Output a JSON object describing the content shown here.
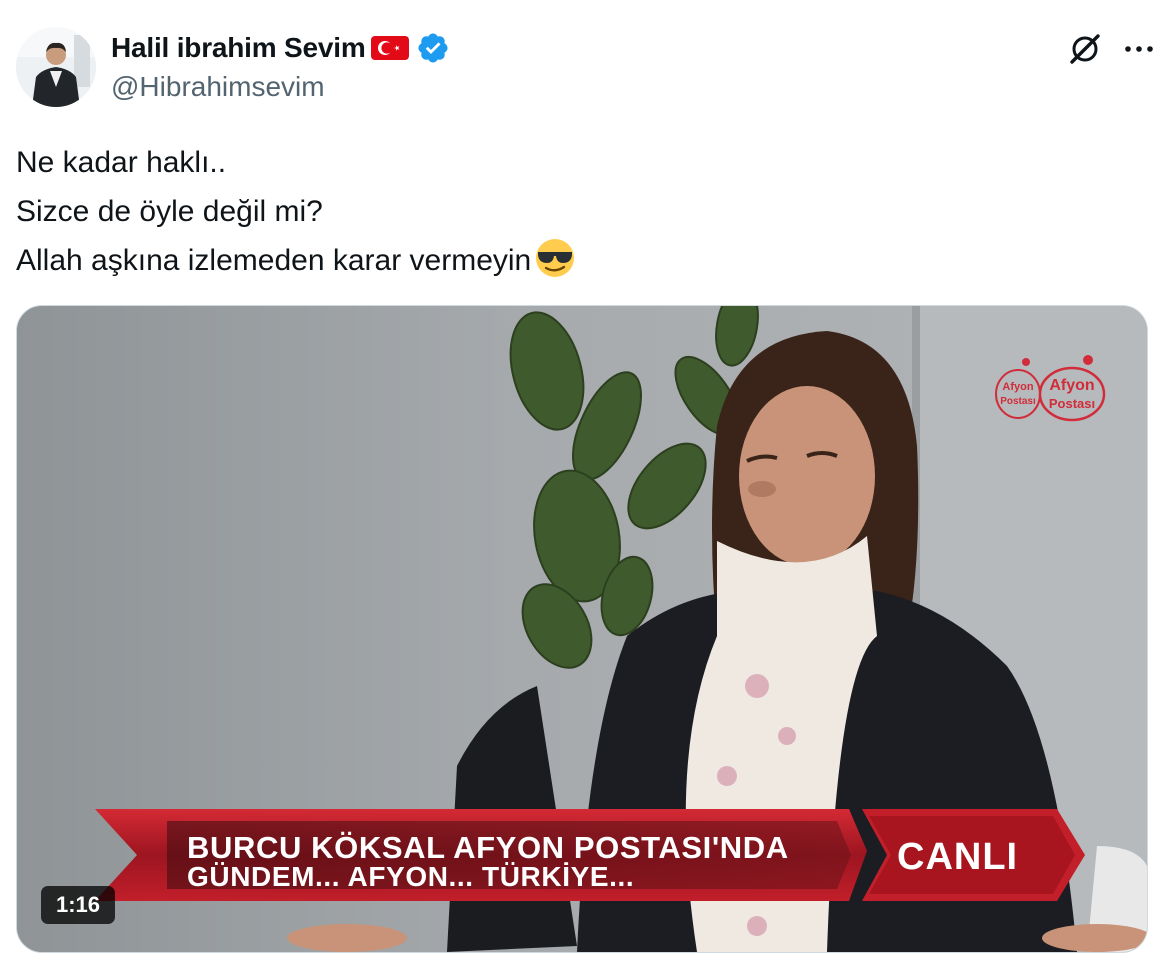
{
  "author": {
    "display_name": "Halil ibrahim Sevim",
    "handle": "@Hibrahimsevim",
    "flag": "turkey-flag-icon",
    "verified": "verified-badge-icon"
  },
  "actions": {
    "grok_icon": "grok-icon",
    "more_icon": "more-options-icon"
  },
  "tweet": {
    "lines": [
      "Ne kadar haklı..",
      "Sizce de öyle değil mi?",
      "Allah aşkına izlemeden karar vermeyin"
    ],
    "trailing_emoji": "sunglasses-emoji"
  },
  "video": {
    "duration": "1:16",
    "channel_logo_text_1": "Afyon Postası",
    "channel_logo_text_2": "Afyon Postası",
    "lower_third_line1": "BURCU KÖKSAL AFYON POSTASI'NDA",
    "lower_third_line2": "GÜNDEM... AFYON... TÜRKİYE...",
    "live_label": "CANLI"
  },
  "colors": {
    "verified_blue": "#1d9bf0",
    "text_primary": "#0f1419",
    "text_secondary": "#536471",
    "banner_red": "#c21f2a"
  }
}
